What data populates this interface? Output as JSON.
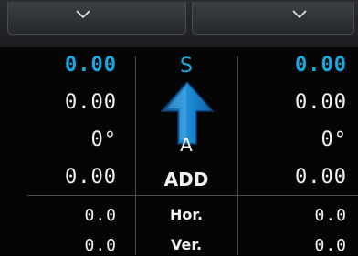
{
  "dropdowns": {
    "left": {
      "icon": "chevron-down-icon"
    },
    "right": {
      "icon": "chevron-down-icon"
    }
  },
  "left_column": {
    "row1": "0.00",
    "row2": "0.00",
    "row3": "0°",
    "row4": "0.00",
    "row5": "0.0",
    "row6": "0.0"
  },
  "center_column": {
    "direction_letter": "S",
    "direction_icon": "arrow-up-icon",
    "letter_a": "A",
    "mode": "ADD",
    "horizontal": "Hor.",
    "vertical": "Ver."
  },
  "right_column": {
    "row1": "0.00",
    "row2": "0.00",
    "row3": "0°",
    "row4": "0.00",
    "row5": "0.0",
    "row6": "0.0"
  },
  "colors": {
    "accent": "#1aa8e0",
    "background": "#050505",
    "text": "#f2f2f2",
    "divider": "#4b4b4b"
  }
}
